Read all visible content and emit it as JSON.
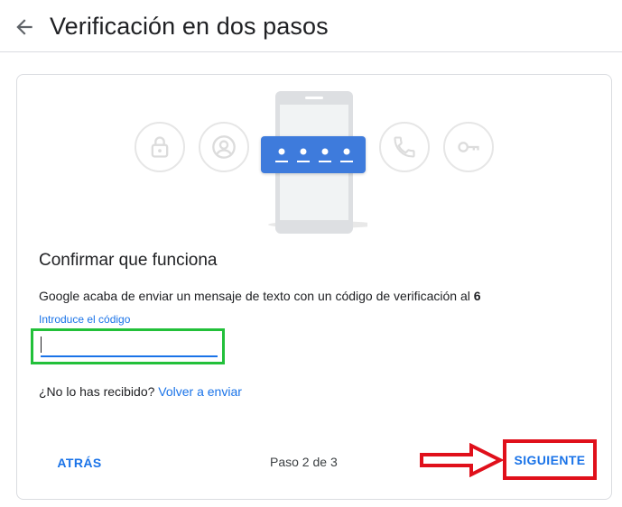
{
  "header": {
    "title": "Verificación en dos pasos",
    "back_icon": "arrow-back-icon"
  },
  "illustration": {
    "icons": [
      "lock-icon",
      "account-icon",
      "phone-call-icon",
      "key-icon"
    ],
    "phone_icon": "phone-icon",
    "code_masked": "••••",
    "accent": "#3e7bdc"
  },
  "card": {
    "heading": "Confirmar que funciona",
    "sms_message": "Google acaba de enviar un mensaje de texto con un código de verificación al",
    "sms_digit": "6",
    "code_label": "Introduce el código",
    "code_value": "",
    "resend_prompt": "¿No lo has recibido?",
    "resend_link": "Volver a enviar"
  },
  "footer": {
    "back_label": "ATRÁS",
    "step_text": "Paso 2 de 3",
    "next_label": "SIGUIENTE"
  },
  "annotations": {
    "input_highlight_color": "#22c03a",
    "next_highlight_color": "#e0101b"
  },
  "colors": {
    "link_blue": "#1a73e8",
    "text": "#202124",
    "divider": "#dadce0"
  }
}
